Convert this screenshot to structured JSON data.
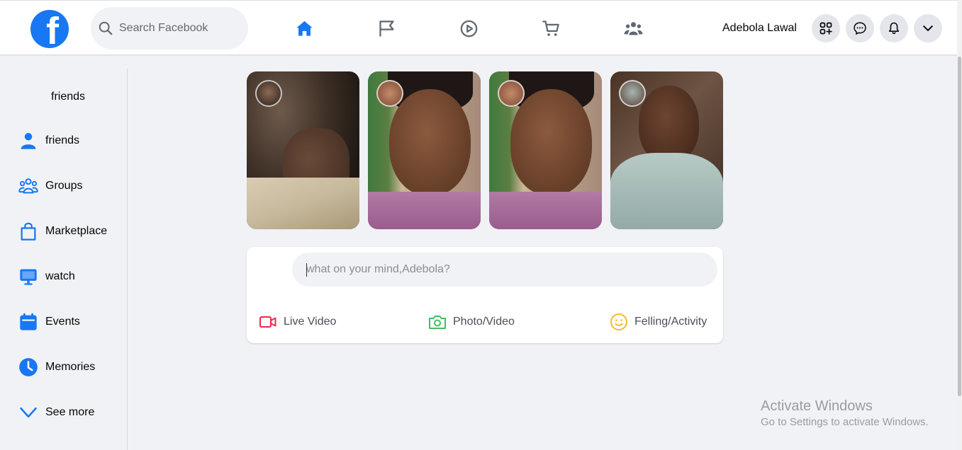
{
  "header": {
    "logo_letter": "f",
    "search_placeholder": "Search Facebook",
    "nav": [
      {
        "icon": "home-icon",
        "active": true
      },
      {
        "icon": "flag-icon"
      },
      {
        "icon": "video-play-icon"
      },
      {
        "icon": "marketplace-cart-icon"
      },
      {
        "icon": "groups-icon"
      }
    ],
    "user_name": "Adebola Lawal",
    "right_buttons": [
      "apps-grid-icon",
      "messenger-icon",
      "bell-icon",
      "chevron-down-icon"
    ]
  },
  "sidebar": {
    "title": "friends",
    "items": [
      {
        "label": "friends",
        "icon": "person-icon"
      },
      {
        "label": "Groups",
        "icon": "groups-icon"
      },
      {
        "label": "Marketplace",
        "icon": "shopping-bag-icon"
      },
      {
        "label": "watch",
        "icon": "monitor-icon"
      },
      {
        "label": "Events",
        "icon": "calendar-icon"
      },
      {
        "label": "Memories",
        "icon": "clock-icon"
      },
      {
        "label": "See more",
        "icon": "chevron-down-icon"
      }
    ]
  },
  "stories": [
    {
      "name": "story-1"
    },
    {
      "name": "story-2"
    },
    {
      "name": "story-3"
    },
    {
      "name": "story-4"
    }
  ],
  "composer": {
    "placeholder": "what on your mind,Adebola?",
    "actions": [
      {
        "label": "Live Video",
        "icon": "video-camera-icon",
        "color": "#f02849"
      },
      {
        "label": "Photo/Video",
        "icon": "camera-icon",
        "color": "#45bd62"
      },
      {
        "label": "Felling/Activity",
        "icon": "smiley-icon",
        "color": "#f7b928"
      }
    ]
  },
  "watermark": {
    "line1": "Activate Windows",
    "line2": "Go to Settings to activate Windows."
  },
  "colors": {
    "accent": "#1877f2",
    "background": "#f0f2f5"
  }
}
